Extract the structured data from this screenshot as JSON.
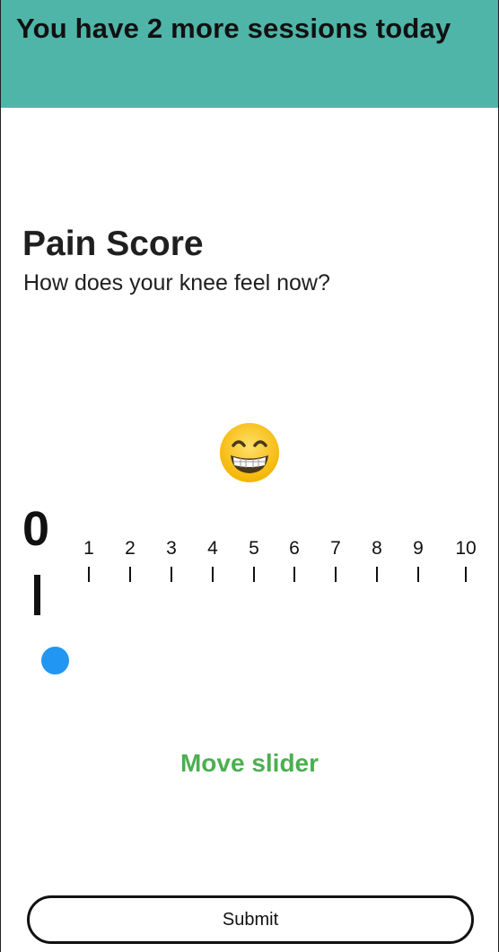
{
  "header": {
    "title": "You have 2 more sessions today",
    "background_color": "#4fb5a8"
  },
  "question": {
    "title": "Pain Score",
    "subtitle": "How does your knee feel now?"
  },
  "face": {
    "icon": "grinning-face-with-smiling-eyes-icon"
  },
  "slider": {
    "current_value": "0",
    "min": 0,
    "max": 10,
    "tick_labels": [
      "1",
      "2",
      "3",
      "4",
      "5",
      "6",
      "7",
      "8",
      "9",
      "10"
    ],
    "thumb_color": "#2196f3"
  },
  "hint": {
    "text": "Move slider",
    "color": "#4caf50"
  },
  "actions": {
    "submit_label": "Submit"
  }
}
